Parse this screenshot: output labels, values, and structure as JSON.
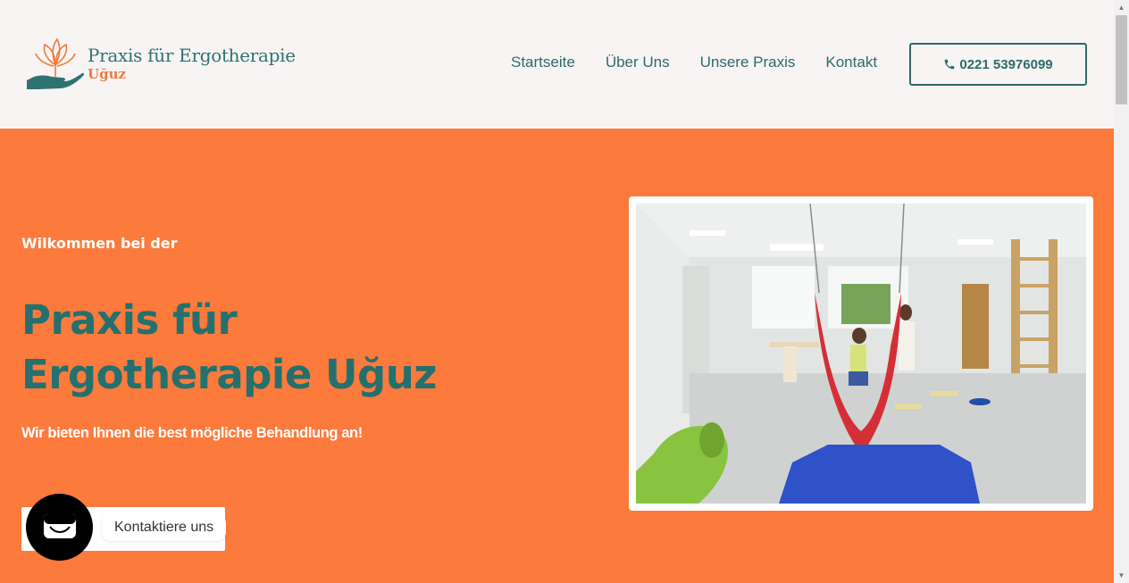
{
  "header": {
    "logo": {
      "line1": "Praxis für Ergotherapie",
      "line2": "Uğuz"
    },
    "nav": [
      {
        "label": "Startseite"
      },
      {
        "label": "Über Uns"
      },
      {
        "label": "Unsere Praxis"
      },
      {
        "label": "Kontakt"
      }
    ],
    "phone": {
      "icon": "phone-icon",
      "label": "0221 53976099"
    }
  },
  "hero": {
    "welcome": "Wilkommen bei der",
    "title": "Praxis für Ergotherapie Uğuz",
    "subtitle": "Wir bieten Ihnen die best mögliche Behandlung an!",
    "cta_label": "",
    "photo": "therapy-room-photo"
  },
  "chat": {
    "icon": "chat-icon",
    "label": "Kontaktiere uns"
  },
  "colors": {
    "accent_orange": "#fc7a3c",
    "teal": "#24706e",
    "header_bg": "#f7f4f3"
  }
}
